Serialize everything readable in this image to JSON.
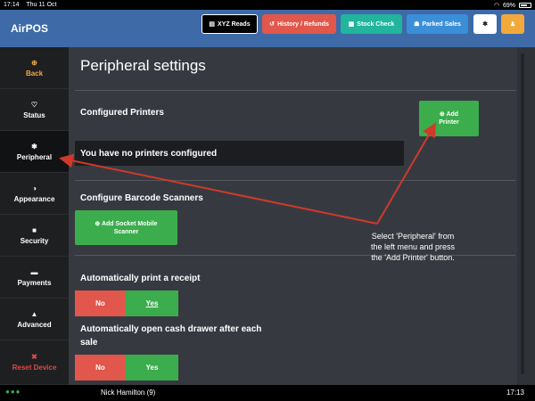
{
  "status_bar": {
    "time": "17:14",
    "date": "Thu 11 Oct",
    "battery": "69%"
  },
  "header": {
    "brand": "AirPOS",
    "buttons": [
      {
        "label": "XYZ Reads",
        "icon": "▤"
      },
      {
        "label": "History / Refunds",
        "icon": "↺"
      },
      {
        "label": "Stock Check",
        "icon": "▦"
      },
      {
        "label": "Parked Sales",
        "icon": "☗"
      }
    ],
    "settings_icon": "✱",
    "user_icon": "♟"
  },
  "sidebar": {
    "items": [
      {
        "label": "Back",
        "icon": "⊕"
      },
      {
        "label": "Status",
        "icon": "♡"
      },
      {
        "label": "Peripheral",
        "icon": "✱"
      },
      {
        "label": "Appearance",
        "icon": "◑"
      },
      {
        "label": "Security",
        "icon": "■"
      },
      {
        "label": "Payments",
        "icon": "▬"
      },
      {
        "label": "Advanced",
        "icon": "▲"
      },
      {
        "label": "Reset Device",
        "icon": "✖"
      }
    ]
  },
  "main": {
    "title": "Peripheral settings",
    "printers": {
      "heading": "Configured Printers",
      "add_button_icon": "⊕",
      "add_button_line1": "Add",
      "add_button_line2": "Printer",
      "empty_message": "You have no printers configured"
    },
    "scanners": {
      "heading": "Configure Barcode Scanners",
      "button_line1": "⊕ Add Socket Mobile",
      "button_line2": "Scanner"
    },
    "print_receipt": {
      "label": "Automatically print a receipt",
      "no": "No",
      "yes": "Yes"
    },
    "cash_drawer": {
      "label_line1": "Automatically open cash drawer after each",
      "label_line2": "sale",
      "no": "No",
      "yes": "Yes"
    }
  },
  "annotation": {
    "line1": "Select 'Peripheral' from",
    "line2": "the left menu and press",
    "line3": "the 'Add Printer' button."
  },
  "footer": {
    "dots": "●●●",
    "user": "Nick Hamilton (9)",
    "time": "17:13"
  },
  "colors": {
    "header": "#3e6aa7",
    "accent_green": "#3cad4d",
    "accent_red": "#e1574b",
    "arrow": "#d0392b"
  }
}
